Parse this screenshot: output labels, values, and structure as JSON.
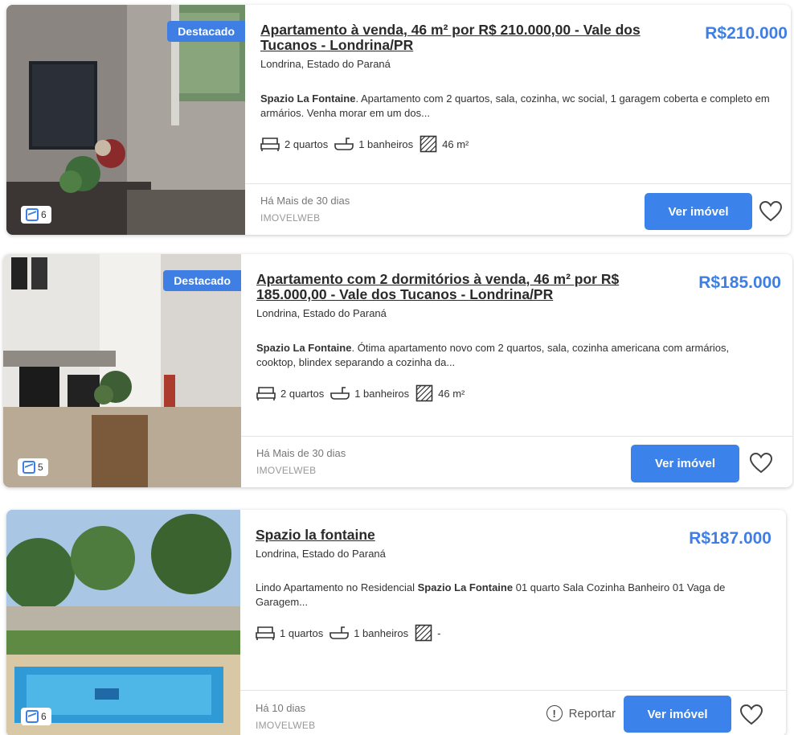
{
  "listings": [
    {
      "badge": "Destacado",
      "photo_count": "6",
      "title": "Apartamento à venda, 46 m² por R$ 210.000,00 - Vale dos Tucanos - Londrina/PR",
      "price": "R$210.000",
      "location": "Londrina, Estado do Paraná",
      "desc_bold": "Spazio La Fontaine",
      "desc_rest": ". Apartamento com 2 quartos, sala, cozinha, wc social, 1 garagem coberta e completo em armários. Venha morar em um dos...",
      "bedrooms": "2 quartos",
      "bathrooms": "1 banheiros",
      "area": "46  m²",
      "age": "Há Mais de 30 dias",
      "source": "IMOVELWEB",
      "button": "Ver imóvel",
      "icons": {
        "bed": "bed-icon",
        "bath": "bathtub-icon",
        "area": "area-icon",
        "fav": "heart-icon"
      }
    },
    {
      "badge": "Destacado",
      "photo_count": "5",
      "title": "Apartamento com 2 dormitórios à venda, 46 m² por R$ 185.000,00 - Vale dos Tucanos - Londrina/PR",
      "price": "R$185.000",
      "location": "Londrina, Estado do Paraná",
      "desc_bold": "Spazio La Fontaine",
      "desc_rest": ". Ótima apartamento novo com 2 quartos, sala, cozinha americana com armários, cooktop, blindex separando a cozinha da...",
      "bedrooms": "2 quartos",
      "bathrooms": "1 banheiros",
      "area": "46  m²",
      "age": "Há Mais de 30 dias",
      "source": "IMOVELWEB",
      "button": "Ver imóvel"
    },
    {
      "photo_count": "6",
      "title": "Spazio la fontaine",
      "price": "R$187.000",
      "location": "Londrina, Estado do Paraná",
      "desc_pre": "Lindo Apartamento no Residencial ",
      "desc_bold": "Spazio La Fontaine",
      "desc_rest": " 01 quarto Sala Cozinha Banheiro 01 Vaga de Garagem...",
      "bedrooms": "1 quartos",
      "bathrooms": "1 banheiros",
      "area": "-",
      "age": "Há 10 dias",
      "source": "IMOVELWEB",
      "report": "Reportar",
      "button": "Ver imóvel"
    }
  ],
  "colors": {
    "accent": "#3f7fe3",
    "button": "#3b82ea"
  }
}
